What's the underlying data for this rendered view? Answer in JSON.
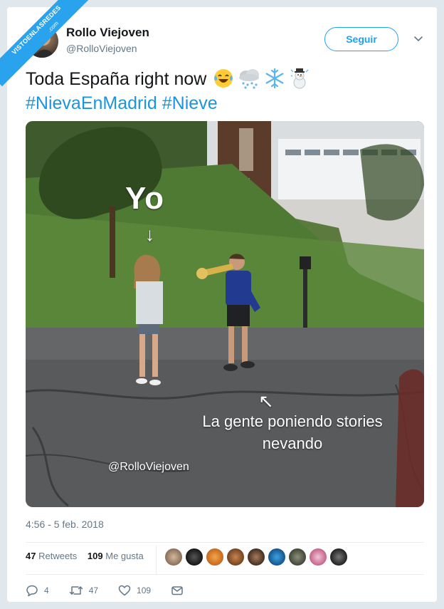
{
  "watermark_ribbon": {
    "line1": "VISTOENLASREDES",
    "line2": ".com"
  },
  "tweet": {
    "author_name": "Rollo Viejoven",
    "author_handle": "@RolloViejoven",
    "follow_label": "Seguir",
    "text_main": "Toda España right now",
    "emojis": [
      "face-with-tears-of-joy",
      "cloud-with-snow",
      "snowflake",
      "snowman"
    ],
    "hashtags": [
      "#NievaEnMadrid",
      "#Nieve"
    ],
    "timestamp": "4:56 - 5 feb. 2018"
  },
  "media": {
    "label_yo": "Yo",
    "arrow_down": "↓",
    "arrow_diag": "↖",
    "caption_line1": "La gente poniendo stories",
    "caption_line2": "nevando",
    "watermark": "@RolloViejoven"
  },
  "stats": {
    "retweets_count": "47",
    "retweets_label": "Retweets",
    "likes_count": "109",
    "likes_label": "Me gusta"
  },
  "actions": {
    "reply_count": "4",
    "retweet_count": "47",
    "like_count": "109"
  },
  "colors": {
    "accent": "#1da1f2",
    "hashtag": "#1b95e0",
    "muted": "#657786",
    "ribbon": "#2aa3ef"
  }
}
